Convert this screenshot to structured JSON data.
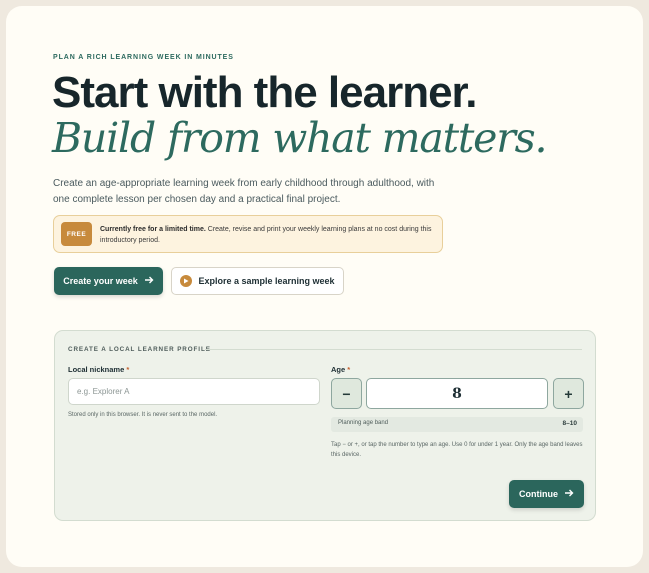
{
  "hero": {
    "eyebrow": "PLAN A RICH LEARNING WEEK IN MINUTES",
    "headline": "Start with the learner.",
    "subheadline": "Build from what matters.",
    "lead": "Create an age-appropriate learning week from early childhood through adulthood, with one complete lesson per chosen day and a practical final project."
  },
  "promo": {
    "badge": "FREE",
    "strong": "Currently free for a limited time.",
    "text": " Create, revise and print your weekly learning plans at no cost during this introductory period."
  },
  "actions": {
    "primary_label": "Create your week",
    "primary_icon": "arrow-right-icon",
    "secondary_label": "Explore a sample learning week",
    "secondary_icon": "play-icon"
  },
  "profile": {
    "title": "CREATE A LOCAL LEARNER PROFILE",
    "nickname_label": "Local nickname",
    "required_mark": "*",
    "nickname_placeholder": "e.g. Explorer A",
    "nickname_value": "",
    "nickname_hint": "Stored only in this browser. It is never sent to the model.",
    "age_label": "Age",
    "age_decrement": "−",
    "age_increment": "+",
    "age_value": "8",
    "band_label": "Planning age band",
    "band_value": "8–10",
    "age_hint": "Tap − or +, or tap the number to type an age. Use 0 for under 1 year. Only the age band leaves this device.",
    "continue_label": "Continue"
  },
  "colors": {
    "accent": "#2b665c",
    "promo_badge": "#c78a3c",
    "background": "#fffdf6"
  }
}
